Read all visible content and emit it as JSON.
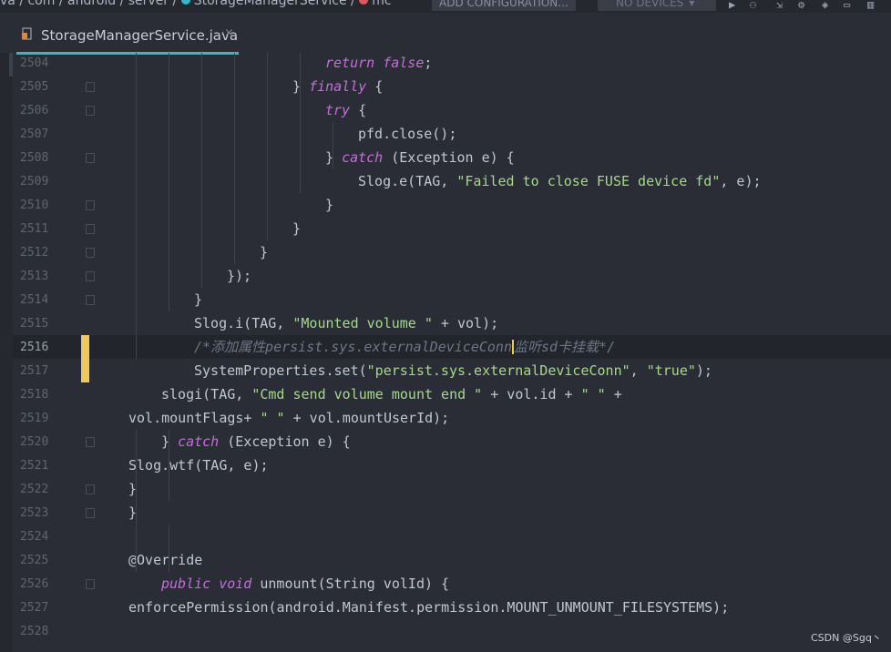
{
  "breadcrumb": {
    "text": "va / com / android / server / ",
    "file": "StorageManagerService",
    "sep": " / ",
    "member": "mc"
  },
  "toolbar": {
    "config_label": "ADD CONFIGURATION...",
    "device_label": "NO DEVICES"
  },
  "tab": {
    "title": "StorageManagerService.java",
    "close": "×"
  },
  "watermark": "CSDN @Sgq丶",
  "colors": {
    "accent": "#3bb5c9",
    "keyword": "#c26fd8",
    "string": "#a6d889",
    "comment": "#6e7585",
    "change_marker": "#f0c75a"
  },
  "lines": [
    {
      "n": "2504",
      "s": [
        [
          "kw",
          "return false"
        ],
        [
          "",
          "; "
        ]
      ]
    },
    {
      "n": "2505",
      "s": [
        [
          "",
          "} "
        ],
        [
          "kw",
          "finally"
        ],
        [
          "",
          " {"
        ]
      ]
    },
    {
      "n": "2506",
      "s": [
        [
          "kw",
          "try"
        ],
        [
          "",
          " {"
        ]
      ]
    },
    {
      "n": "2507",
      "s": [
        [
          "",
          "pfd.close();"
        ]
      ]
    },
    {
      "n": "2508",
      "s": [
        [
          "",
          "} "
        ],
        [
          "kw",
          "catch"
        ],
        [
          "",
          " (Exception e) {"
        ]
      ]
    },
    {
      "n": "2509",
      "s": [
        [
          "",
          "Slog.e(TAG, "
        ],
        [
          "str",
          "\"Failed to close FUSE device fd\""
        ],
        [
          "",
          ", e);"
        ]
      ]
    },
    {
      "n": "2510",
      "s": [
        [
          "",
          "}"
        ]
      ]
    },
    {
      "n": "2511",
      "s": [
        [
          "",
          "}"
        ]
      ]
    },
    {
      "n": "2512",
      "s": [
        [
          "",
          "}"
        ]
      ]
    },
    {
      "n": "2513",
      "s": [
        [
          "",
          "});"
        ]
      ]
    },
    {
      "n": "2514",
      "s": [
        [
          "",
          "}"
        ]
      ]
    },
    {
      "n": "2515",
      "s": [
        [
          "",
          "Slog.i(TAG, "
        ],
        [
          "str",
          "\"Mounted volume \""
        ],
        [
          "",
          " + vol);"
        ]
      ]
    },
    {
      "n": "2516",
      "s": [
        [
          "cmt",
          "/*添加属性persist.sys.externalDeviceConn"
        ],
        [
          "caret",
          ""
        ],
        [
          "cmt",
          "监听sd卡挂载*/"
        ]
      ]
    },
    {
      "n": "2517",
      "s": [
        [
          "",
          "SystemProperties.set("
        ],
        [
          "str",
          "\"persist.sys.externalDeviceConn\""
        ],
        [
          "",
          ", "
        ],
        [
          "str",
          "\"true\""
        ],
        [
          "",
          ");"
        ]
      ]
    },
    {
      "n": "2518",
      "s": [
        [
          "",
          "slogi(TAG, "
        ],
        [
          "str",
          "\"Cmd send volume mount end \""
        ],
        [
          "",
          " + vol.id + "
        ],
        [
          "str",
          "\" \""
        ],
        [
          "",
          " +"
        ]
      ]
    },
    {
      "n": "2519",
      "s": [
        [
          "",
          "vol.mountFlags+ "
        ],
        [
          "str",
          "\" \""
        ],
        [
          "",
          " + vol.mountUserId);"
        ]
      ]
    },
    {
      "n": "2520",
      "s": [
        [
          "",
          "} "
        ],
        [
          "kw",
          "catch"
        ],
        [
          "",
          " (Exception e) {"
        ]
      ]
    },
    {
      "n": "2521",
      "s": [
        [
          "",
          "Slog.wtf(TAG, e);"
        ]
      ]
    },
    {
      "n": "2522",
      "s": [
        [
          "",
          "}"
        ]
      ]
    },
    {
      "n": "2523",
      "s": [
        [
          "",
          "}"
        ]
      ]
    },
    {
      "n": "2524",
      "s": []
    },
    {
      "n": "2525",
      "s": [
        [
          "ann",
          "@Override"
        ]
      ]
    },
    {
      "n": "2526",
      "s": [
        [
          "kw",
          "public void"
        ],
        [
          "",
          " unmount(String volId) {"
        ]
      ]
    },
    {
      "n": "2527",
      "s": [
        [
          "",
          "enforcePermission(android.Manifest.permission.MOUNT_UNMOUNT_FILESYSTEMS);"
        ]
      ]
    },
    {
      "n": "2528",
      "s": []
    }
  ]
}
